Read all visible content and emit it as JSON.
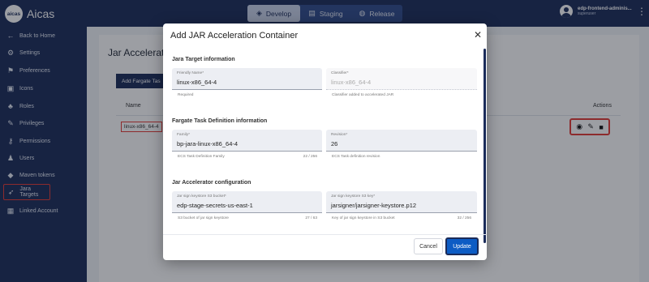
{
  "app": {
    "logo_mark": "aicas",
    "name": "Aicas"
  },
  "env_tabs": [
    {
      "label": "Develop",
      "icon": "layers-icon",
      "active": true
    },
    {
      "label": "Staging",
      "icon": "document-icon",
      "active": false
    },
    {
      "label": "Release",
      "icon": "globe-icon",
      "active": false
    }
  ],
  "user": {
    "name": "edp-frontend-adminis...",
    "role": "superuser"
  },
  "sidebar": {
    "items": [
      {
        "label": "Back to Home",
        "icon": "arrow-left-icon"
      },
      {
        "label": "Settings",
        "icon": "gear-icon"
      },
      {
        "label": "Preferences",
        "icon": "signpost-icon"
      },
      {
        "label": "Icons",
        "icon": "image-icon"
      },
      {
        "label": "Roles",
        "icon": "roles-icon"
      },
      {
        "label": "Privileges",
        "icon": "privileges-icon"
      },
      {
        "label": "Permissions",
        "icon": "key-icon"
      },
      {
        "label": "Users",
        "icon": "users-icon"
      },
      {
        "label": "Maven tokens",
        "icon": "maven-icon"
      },
      {
        "label": "Jara Targets",
        "icon": "rocket-icon",
        "selected": true
      },
      {
        "label": "Linked Account",
        "icon": "linked-account-icon"
      }
    ]
  },
  "page": {
    "title": "Jar Accelerato",
    "add_button": "Add Fargate Tas",
    "columns": {
      "name": "Name",
      "actions": "Actions"
    },
    "row": {
      "name": "linux-x86_64-4"
    }
  },
  "modal": {
    "title": "Add JAR Acceleration Container",
    "sections": {
      "target": "Jara Target information",
      "fargate": "Fargate Task Definition information",
      "accelerator": "Jar Accelerator configuration"
    },
    "fields": {
      "friendly_name": {
        "label": "Friendly Name*",
        "value": "linux-x86_64-4",
        "helper": "Required"
      },
      "classifier": {
        "label": "Classifier*",
        "value": "linux-x86_64-4",
        "helper": "Classifier added to accelerated JAR"
      },
      "family": {
        "label": "Family*",
        "value": "bp-jara-linux-x86_64-4",
        "helper": "ECS Task Definition Family",
        "counter": "22 / 256"
      },
      "revision": {
        "label": "Revision*",
        "value": "26",
        "helper": "ECS Task definition revision"
      },
      "keystore_bucket": {
        "label": "Jar sign keystore S3 bucket*",
        "value": "edp-stage-secrets-us-east-1",
        "helper": "S3 bucket of jar sign keystore",
        "counter": "27 / 63"
      },
      "keystore_key": {
        "label": "Jar sign keystore S3 key*",
        "value": "jarsigner/jarsigner-keystore.p12",
        "helper": "Key of jar sign keystore in S3 bucket",
        "counter": "32 / 256"
      }
    },
    "cancel_label": "Cancel",
    "update_label": "Update"
  },
  "colors": {
    "nav_bg": "#1a2b59",
    "primary": "#0d5cc4",
    "highlight": "#e53935"
  }
}
